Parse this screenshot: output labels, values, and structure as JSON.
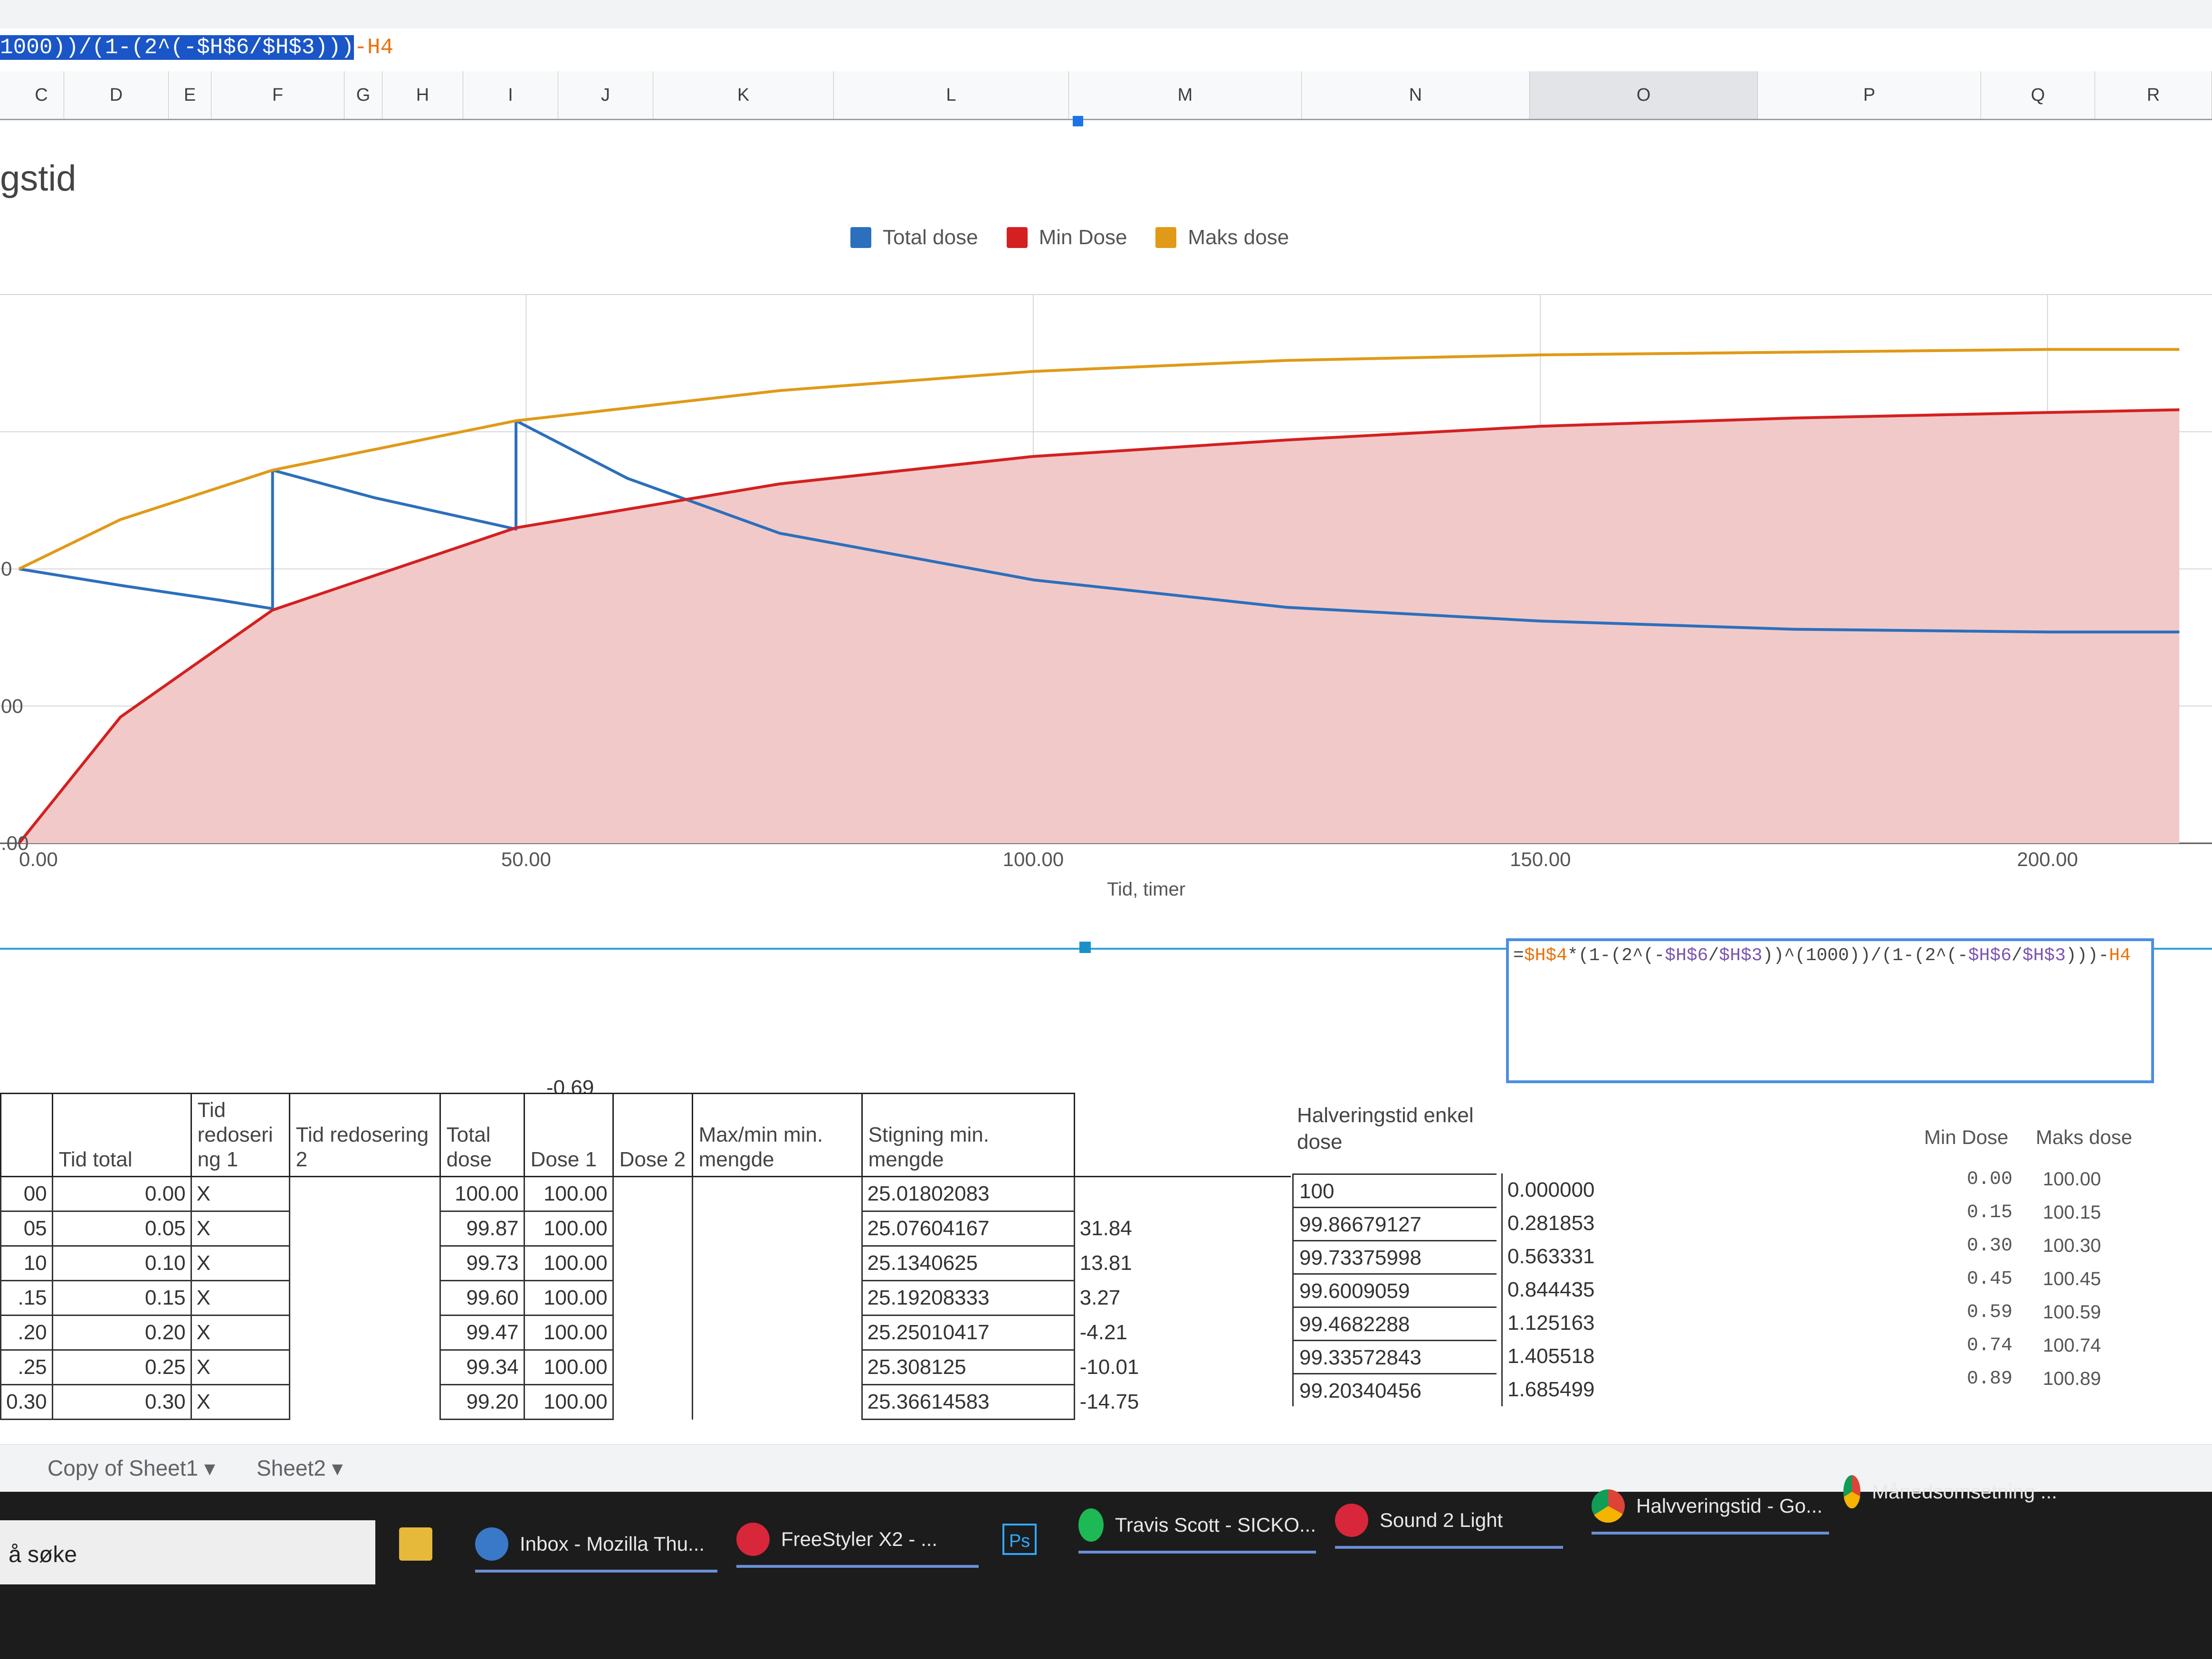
{
  "formula_bar": {
    "selected": "1000))/(1-(2^(-$H$6/$H$3)))",
    "tail": "-H4"
  },
  "columns": [
    "C",
    "D",
    "E",
    "F",
    "G",
    "H",
    "I",
    "J",
    "K",
    "L",
    "M",
    "N",
    "O",
    "P",
    "Q",
    "R"
  ],
  "chart": {
    "title_visible": "gstid"
  },
  "chart_data": {
    "type": "line",
    "legend_position": "top",
    "xlabel": "Tid, timer",
    "xticks": [
      "0.00",
      "50.00",
      "100.00",
      "150.00",
      "200.00"
    ],
    "ytick_fragments": [
      "0",
      "00",
      ".00"
    ],
    "xlim": [
      0,
      215
    ],
    "series": [
      {
        "name": "Total dose",
        "color": "#2c6fbd",
        "x": [
          0,
          10,
          20,
          25,
          25,
          35,
          49,
          49,
          60,
          75,
          100,
          125,
          150,
          175,
          200,
          213
        ],
        "y": [
          100,
          94,
          88.5,
          85.5,
          136,
          126,
          114.5,
          154,
          133,
          113,
          96,
          86,
          81,
          78,
          77,
          77
        ]
      },
      {
        "name": "Min Dose",
        "color": "#d42020",
        "fill": "#f1c9c9",
        "x": [
          0,
          10,
          25,
          49,
          75,
          100,
          125,
          150,
          175,
          200,
          213
        ],
        "y": [
          0,
          46,
          85,
          115,
          131,
          141,
          147,
          152,
          155,
          157,
          158
        ]
      },
      {
        "name": "Maks dose",
        "color": "#e09a18",
        "x": [
          0,
          10,
          25,
          49,
          75,
          100,
          125,
          150,
          175,
          200,
          213
        ],
        "y": [
          100,
          118,
          136,
          154,
          165,
          172,
          176,
          178,
          179,
          180,
          180
        ]
      }
    ]
  },
  "formula_edit": {
    "p1": "=",
    "p2": "$H$4",
    "p3": "*(1-(2^(-",
    "p4": "$H$6",
    "p5": "/",
    "p6": "$H$3",
    "p7": "))^(1000))/(1-(2^(-",
    "p8": "$H$6",
    "p9": "/",
    "p10": "$H$3",
    "p11": ")))-",
    "p12": "H4"
  },
  "cell_neg": "-0.69",
  "table": {
    "headers": [
      "",
      "Tid total",
      "Tid redoseri ng 1",
      "Tid redosering 2",
      "Total dose",
      "Dose 1",
      "Dose 2",
      "Max/min min. mengde",
      "Stigning min. mengde",
      ""
    ],
    "rows": [
      [
        "00",
        "0.00",
        "X",
        "",
        "",
        "100.00",
        "100.00",
        "",
        "",
        "25.01802083",
        ""
      ],
      [
        "05",
        "0.05",
        "X",
        "",
        "",
        "99.87",
        "100.00",
        "",
        "",
        "25.07604167",
        "31.84"
      ],
      [
        "10",
        "0.10",
        "X",
        "",
        "",
        "99.73",
        "100.00",
        "",
        "",
        "25.1340625",
        "13.81"
      ],
      [
        ".15",
        "0.15",
        "X",
        "",
        "",
        "99.60",
        "100.00",
        "",
        "",
        "25.19208333",
        "3.27"
      ],
      [
        ".20",
        "0.20",
        "X",
        "",
        "",
        "99.47",
        "100.00",
        "",
        "",
        "25.25010417",
        "-4.21"
      ],
      [
        ".25",
        "0.25",
        "X",
        "",
        "",
        "99.34",
        "100.00",
        "",
        "",
        "25.308125",
        "-10.01"
      ],
      [
        "0.30",
        "0.30",
        "X",
        "",
        "",
        "99.20",
        "100.00",
        "",
        "",
        "25.36614583",
        "-14.75"
      ]
    ]
  },
  "halvering": {
    "header": "Halveringstid enkel dose",
    "values": [
      "100",
      "99.86679127",
      "99.73375998",
      "99.6009059",
      "99.4682288",
      "99.33572843",
      "99.20340456"
    ]
  },
  "fractions": [
    "0.000000",
    "0.281853",
    "0.563331",
    "0.844435",
    "1.125163",
    "1.405518",
    "1.685499"
  ],
  "right_table": {
    "headers": [
      "Min Dose",
      "Maks dose"
    ],
    "rows": [
      [
        "0.00",
        "100.00"
      ],
      [
        "0.15",
        "100.15"
      ],
      [
        "0.30",
        "100.30"
      ],
      [
        "0.45",
        "100.45"
      ],
      [
        "0.59",
        "100.59"
      ],
      [
        "0.74",
        "100.74"
      ],
      [
        "0.89",
        "100.89"
      ]
    ]
  },
  "sheet_tabs": [
    "Copy of Sheet1",
    "Sheet2"
  ],
  "taskbar": {
    "search": "å søke",
    "items": [
      "Inbox - Mozilla Thu...",
      "FreeStyler X2 - ...",
      "Ps",
      "Travis Scott - SICKO...",
      "Sound 2 Light",
      "Halvveringstid - Go...",
      "Månedsomsetning ..."
    ]
  }
}
